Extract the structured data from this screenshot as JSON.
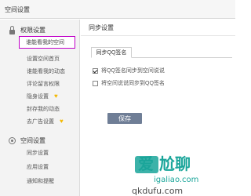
{
  "window": {
    "title": "空间设置"
  },
  "sidebar": {
    "sections": [
      {
        "title": "权限设置",
        "icon": "lock-icon",
        "items": [
          {
            "label": "谁能看我的空间",
            "active": true
          },
          {
            "label": "设置空间首页"
          },
          {
            "label": "谁能看我的动态"
          },
          {
            "label": "评论留言权限"
          },
          {
            "label": "隐身设置",
            "badge": "heart-icon"
          },
          {
            "label": "封存我的动态"
          },
          {
            "label": "去广告设置",
            "badge": "heart-icon"
          }
        ]
      },
      {
        "title": "空间设置",
        "icon": "space-icon",
        "items": [
          {
            "label": "同步设置"
          },
          {
            "label": "应用设置"
          },
          {
            "label": "通知和提醒"
          }
        ]
      }
    ]
  },
  "main": {
    "title": "同步设置",
    "tab_label": "同步QQ签名",
    "options": [
      {
        "label": "将QQ签名同步到空间说说",
        "checked": true
      },
      {
        "label": "将空间说说同步到QQ签名",
        "checked": false
      }
    ],
    "save_label": "保存"
  },
  "watermark": {
    "text_top": "爱 尬聊",
    "text_bottom": "igaliao.com",
    "text_url": "qkdufu.com"
  },
  "colors": {
    "highlight_border": "#c000c8",
    "save_button": "#6f7e96",
    "badge": "#f3b800",
    "watermark_teal": "#1aa59a"
  }
}
